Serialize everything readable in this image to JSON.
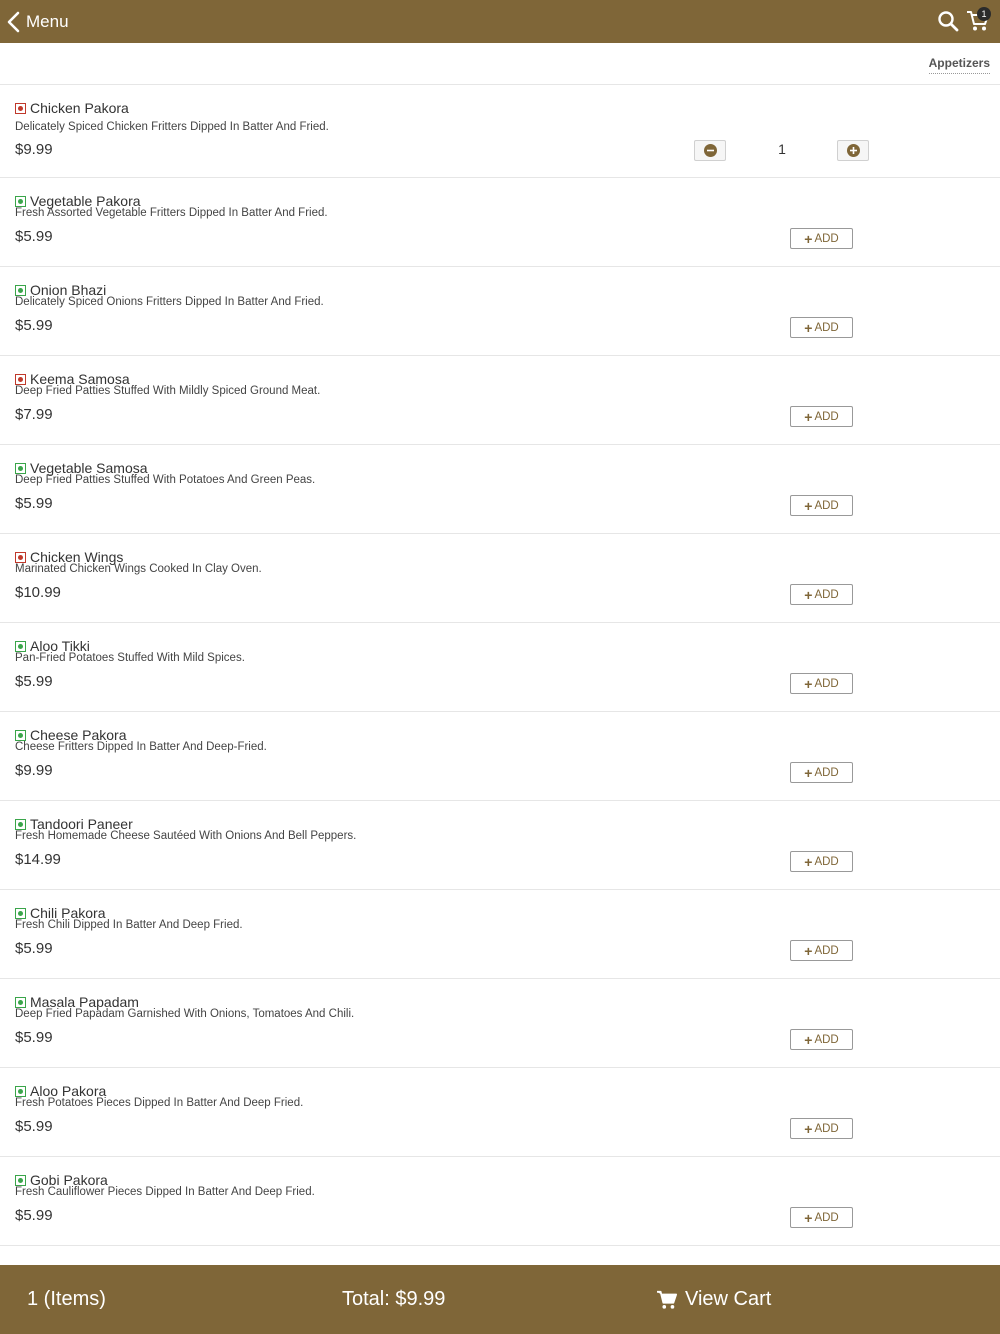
{
  "header": {
    "back_label": "Menu",
    "cart_count": "1",
    "bar_color": "#7f6638"
  },
  "category_tab": "Appetizers",
  "cart_item": {
    "quantity": "1"
  },
  "add_label": "ADD",
  "items": [
    {
      "name": "Chicken Pakora",
      "description": "Delicately Spiced Chicken Fritters Dipped In Batter And Fried.",
      "price": "$9.99",
      "diet": "non-veg"
    },
    {
      "name": "Vegetable Pakora",
      "description": "Fresh Assorted Vegetable Fritters Dipped In Batter And Fried.",
      "price": "$5.99",
      "diet": "veg"
    },
    {
      "name": "Onion Bhazi",
      "description": "Delicately Spiced Onions Fritters Dipped In Batter And Fried.",
      "price": "$5.99",
      "diet": "veg"
    },
    {
      "name": "Keema Samosa",
      "description": "Deep Fried Patties Stuffed With Mildly Spiced Ground Meat.",
      "price": "$7.99",
      "diet": "non-veg"
    },
    {
      "name": "Vegetable Samosa",
      "description": "Deep Fried Patties Stuffed With Potatoes And Green Peas.",
      "price": "$5.99",
      "diet": "veg"
    },
    {
      "name": "Chicken Wings",
      "description": "Marinated Chicken Wings Cooked In Clay Oven.",
      "price": "$10.99",
      "diet": "non-veg"
    },
    {
      "name": "Aloo Tikki",
      "description": "Pan-Fried Potatoes Stuffed With Mild Spices.",
      "price": "$5.99",
      "diet": "veg"
    },
    {
      "name": "Cheese Pakora",
      "description": "Cheese Fritters Dipped In Batter And Deep-Fried.",
      "price": "$9.99",
      "diet": "veg"
    },
    {
      "name": "Tandoori Paneer",
      "description": "Fresh Homemade Cheese Sautéed With Onions And Bell Peppers.",
      "price": "$14.99",
      "diet": "veg"
    },
    {
      "name": "Chili Pakora",
      "description": "Fresh Chili Dipped In Batter And Deep Fried.",
      "price": "$5.99",
      "diet": "veg"
    },
    {
      "name": "Masala Papadam",
      "description": "Deep Fried Papadam Garnished With Onions, Tomatoes And Chili.",
      "price": "$5.99",
      "diet": "veg"
    },
    {
      "name": "Aloo Pakora",
      "description": "Fresh Potatoes Pieces Dipped In Batter And Deep Fried.",
      "price": "$5.99",
      "diet": "veg"
    },
    {
      "name": "Gobi Pakora",
      "description": "Fresh Cauliflower Pieces Dipped In Batter And Deep Fried.",
      "price": "$5.99",
      "diet": "veg"
    }
  ],
  "footer": {
    "items_label": "1 (Items)",
    "total_label": "Total: $9.99",
    "view_cart_label": "View Cart"
  }
}
